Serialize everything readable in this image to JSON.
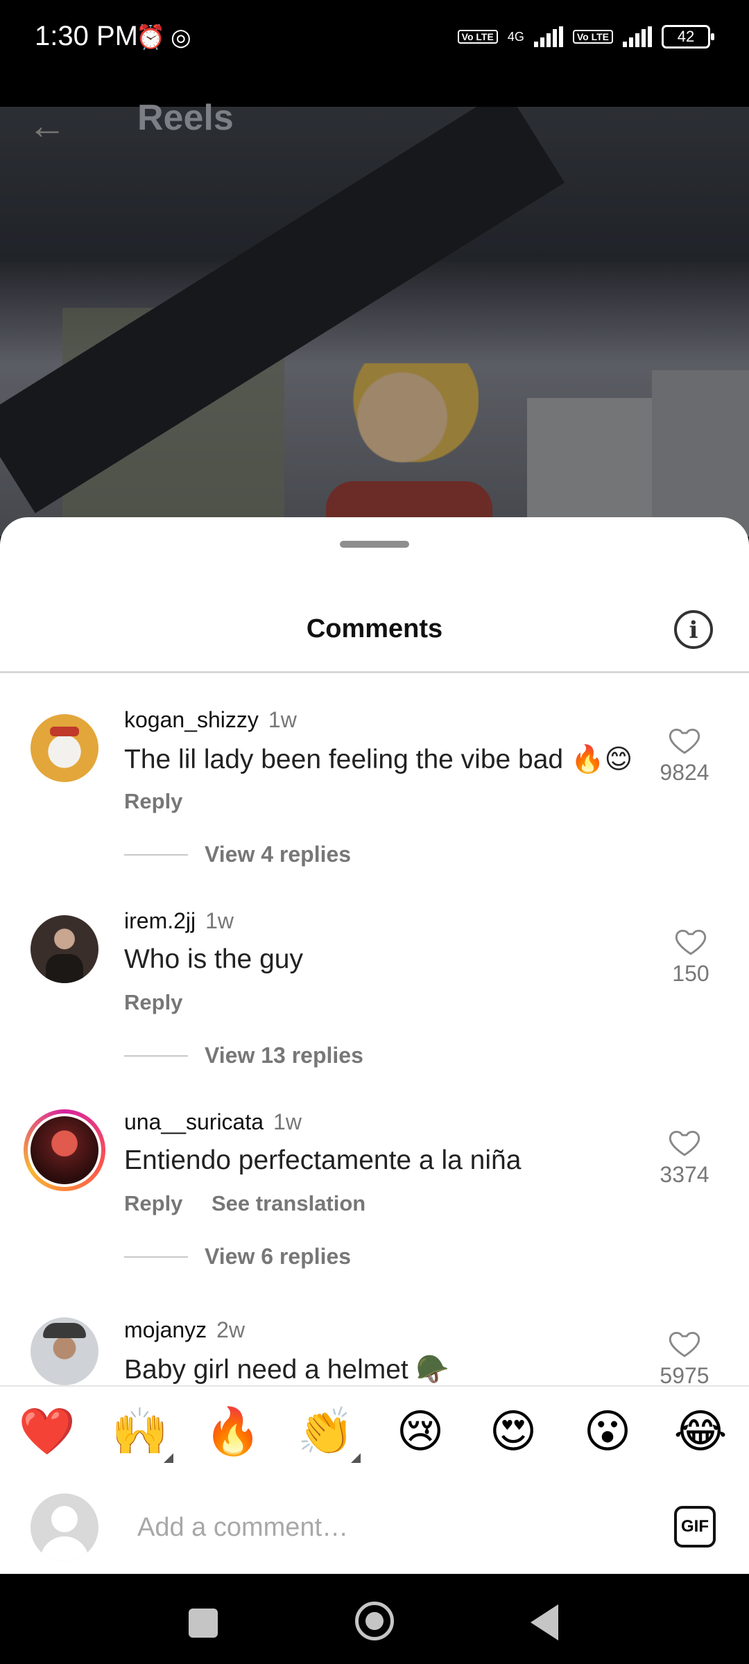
{
  "status_bar": {
    "time": "1:30 PM",
    "network": "4G",
    "lte1": "Vo LTE",
    "lte2": "Vo LTE",
    "battery": "42"
  },
  "header": {
    "title": "Reels"
  },
  "sheet": {
    "title": "Comments"
  },
  "comments": [
    {
      "username": "kogan_shizzy",
      "time": "1w",
      "text": "The lil lady been feeling the vibe bad 🔥😊",
      "reply": "Reply",
      "view_replies": "View 4 replies",
      "likes": "9824"
    },
    {
      "username": "irem.2jj",
      "time": "1w",
      "text": "Who is the guy",
      "reply": "Reply",
      "view_replies": "View 13 replies",
      "likes": "150"
    },
    {
      "username": "una__suricata",
      "time": "1w",
      "text": "Entiendo perfectamente a la niña",
      "reply": "Reply",
      "translation": "See translation",
      "view_replies": "View 6 replies",
      "likes": "3374"
    },
    {
      "username": "mojanyz",
      "time": "2w",
      "text": "Baby girl need a helmet 🪖",
      "likes": "5975"
    }
  ],
  "emoji_bar": [
    "❤️",
    "🙌",
    "🔥",
    "👏",
    "😢",
    "😍",
    "😮",
    "😂"
  ],
  "input": {
    "placeholder": "Add a comment…",
    "gif_label": "GIF"
  }
}
